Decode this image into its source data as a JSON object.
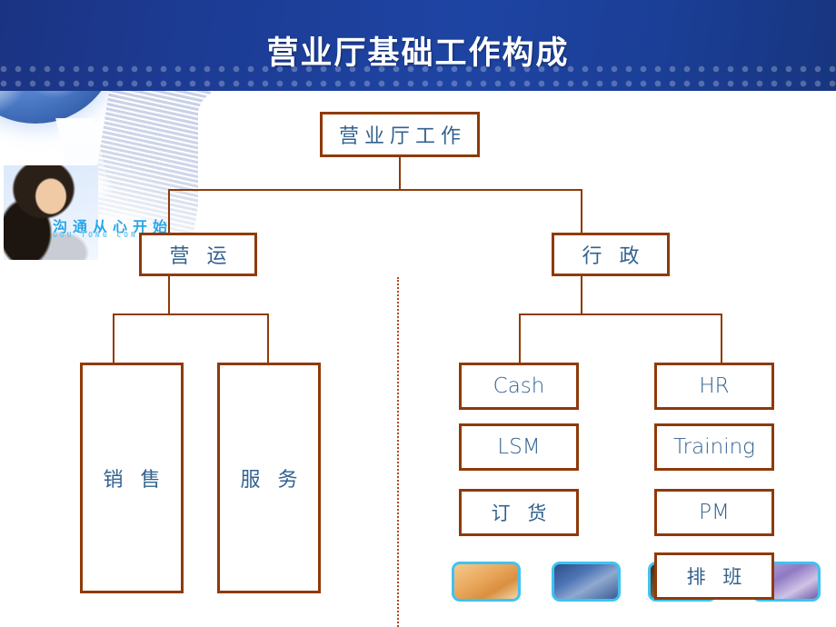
{
  "slide": {
    "title": "营业厅基础工作构成",
    "slogan": "沟通从心开始",
    "slogan_latin": "GOU TONG CON",
    "accent_border": "#8f3a08",
    "text_color": "#33628f",
    "header_blue": "#1c3b93",
    "thumb_border": "#3fc3f0"
  },
  "chart": {
    "root": {
      "label": "营业厅工作"
    },
    "branches": [
      {
        "label": "营 运",
        "children": [
          {
            "label": "销 售"
          },
          {
            "label": "服 务"
          }
        ]
      },
      {
        "label": "行 政",
        "children": [
          {
            "label": "Cash"
          },
          {
            "label": "LSM"
          },
          {
            "label": "订 货"
          },
          {
            "label": "HR"
          },
          {
            "label": "Training"
          },
          {
            "label": "PM"
          },
          {
            "label": "排 班"
          }
        ]
      }
    ]
  },
  "thumbnails": [
    {
      "name": "photo-thumb-woman-smiling"
    },
    {
      "name": "photo-thumb-couple-laptop"
    },
    {
      "name": "photo-thumb-keyboard"
    },
    {
      "name": "photo-thumb-abstract"
    }
  ]
}
